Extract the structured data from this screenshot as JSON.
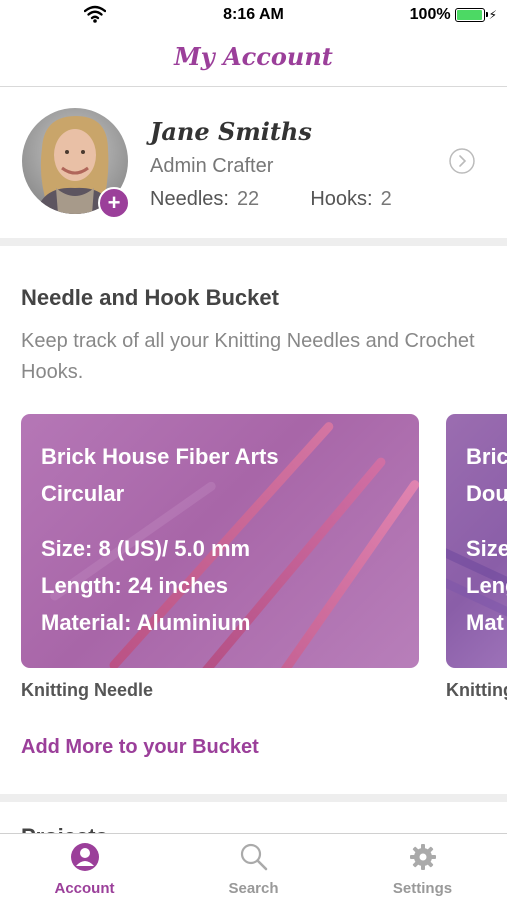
{
  "status_bar": {
    "time": "8:16 AM",
    "battery_pct": "100%",
    "battery_level": 1.0
  },
  "nav": {
    "title": "My Account"
  },
  "profile": {
    "name": "Jane Smiths",
    "role": "Admin Crafter",
    "needles_label": "Needles:",
    "needles_count": "22",
    "hooks_label": "Hooks:",
    "hooks_count": "2",
    "avatar_add_icon": "+"
  },
  "bucket": {
    "title": "Needle and Hook Bucket",
    "description": "Keep track of all your Knitting Needles and Crochet Hooks.",
    "cards": [
      {
        "brand": "Brick House Fiber Arts",
        "style": "Circular",
        "size": "Size: 8 (US)/ 5.0 mm",
        "length": "Length: 24 inches",
        "material": "Material: Aluminium",
        "caption": "Knitting Needle"
      },
      {
        "brand": "Bric",
        "style": "Dou",
        "size": "Size",
        "length": "Leng",
        "material": "Mat",
        "caption": "Knitting"
      }
    ],
    "add_more_label": "Add More to your Bucket"
  },
  "next_section": {
    "title": "Projects"
  },
  "tabs": [
    {
      "label": "Account",
      "icon": "account-icon",
      "active": true
    },
    {
      "label": "Search",
      "icon": "search-icon",
      "active": false
    },
    {
      "label": "Settings",
      "icon": "gear-icon",
      "active": false
    }
  ],
  "colors": {
    "accent": "#9b3f9a",
    "card": "#a866a8",
    "battery": "#4cd964"
  }
}
